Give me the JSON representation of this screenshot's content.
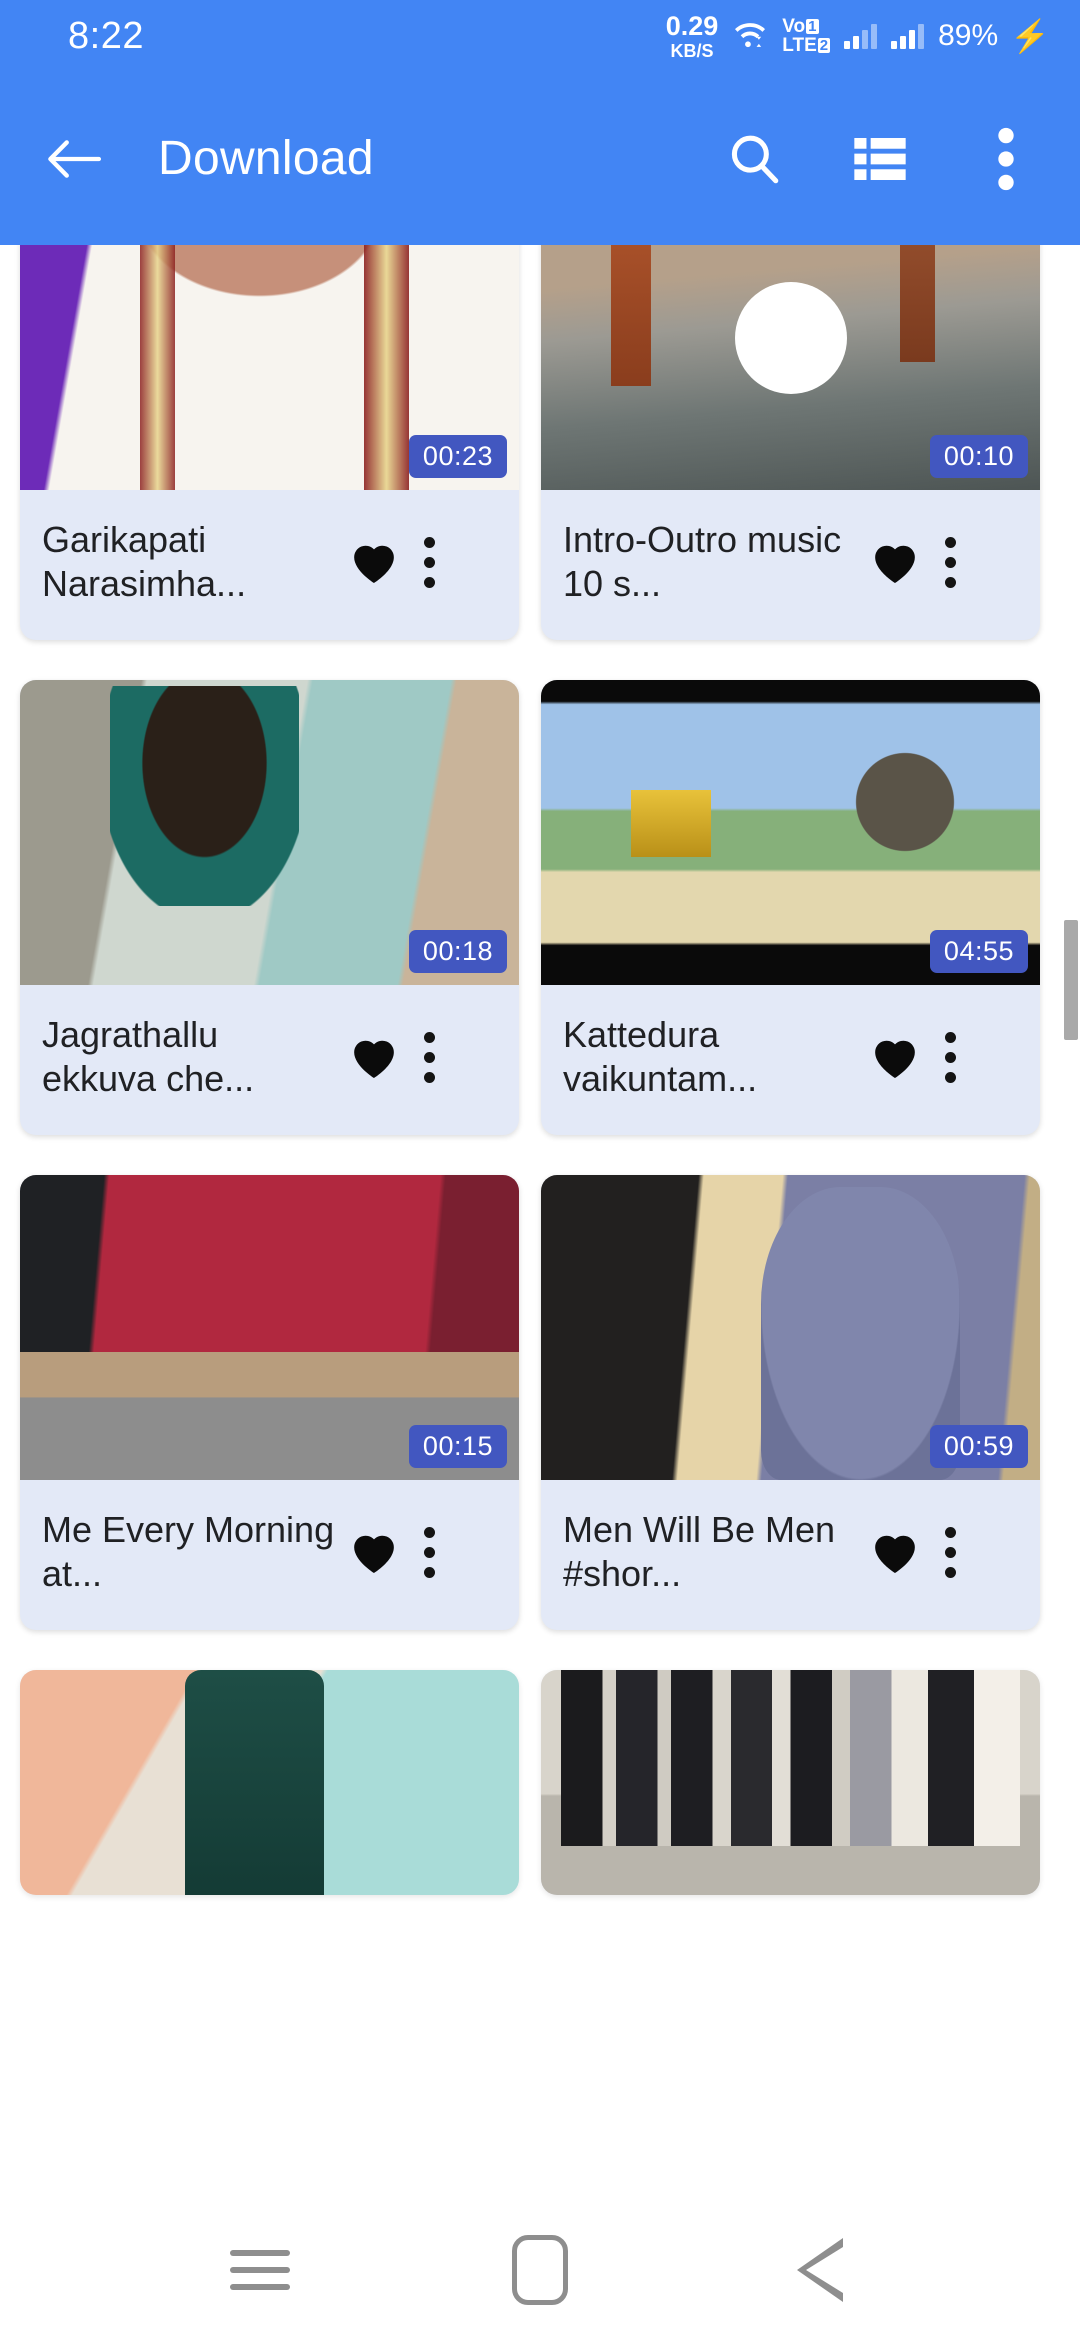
{
  "status_bar": {
    "clock": "8:22",
    "net_speed_value": "0.29",
    "net_speed_unit": "KB/S",
    "wifi_icon": "wifi-icon",
    "volte_line1": "Vo",
    "volte_box1": "1",
    "volte_line2": "LTE",
    "volte_box2": "2",
    "battery": "89%",
    "charging_icon": "lightning-bolt-icon"
  },
  "app_bar": {
    "back_icon": "arrow-back-icon",
    "title": "Download",
    "search_icon": "search-icon",
    "view_list_icon": "view-list-icon",
    "overflow_icon": "more-vert-icon"
  },
  "accent_colors": {
    "app_bar_blue": "#4285f4",
    "duration_badge_blue": "#4257c0",
    "card_bg": "#e3e9f7",
    "title_text": "#202124",
    "nav_icon_gray": "#8e8e8e",
    "scrollbar_gray": "#a9a9a9",
    "charging_green": "#28e070"
  },
  "grid": {
    "videos": [
      {
        "title": "Garikapati Narasimha...",
        "duration": "00:23",
        "favorited": true,
        "has_play_overlay": false,
        "art": "t1"
      },
      {
        "title": "Intro-Outro music 10 s...",
        "duration": "00:10",
        "favorited": true,
        "has_play_overlay": true,
        "art": "t2"
      },
      {
        "title": "Jagrathallu ekkuva che...",
        "duration": "00:18",
        "favorited": true,
        "has_play_overlay": false,
        "art": "t3"
      },
      {
        "title": "Kattedura vaikuntam...",
        "duration": "04:55",
        "favorited": true,
        "has_play_overlay": false,
        "art": "t4"
      },
      {
        "title": "Me Every Morning at...",
        "duration": "00:15",
        "favorited": true,
        "has_play_overlay": false,
        "art": "t5"
      },
      {
        "title": "Men Will Be Men #shor...",
        "duration": "00:59",
        "favorited": true,
        "has_play_overlay": false,
        "art": "t6"
      }
    ],
    "partial_row_art": [
      "t7",
      "t8"
    ],
    "favorite_icon": "heart-filled-icon",
    "overflow_icon": "more-vert-icon",
    "scrollbar": "scrollbar-thumb"
  },
  "nav_bar": {
    "recent_icon": "recent-apps-icon",
    "home_icon": "home-icon",
    "back_icon": "back-triangle-icon"
  }
}
